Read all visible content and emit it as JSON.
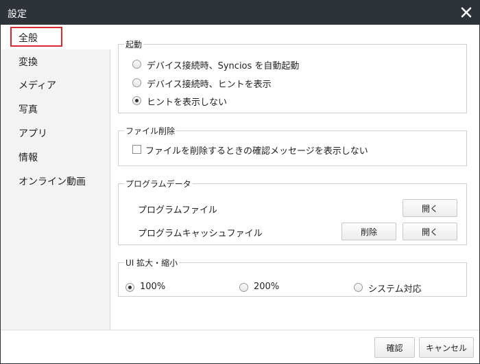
{
  "window": {
    "title": "設定"
  },
  "sidebar": {
    "items": [
      {
        "label": "全般",
        "selected": true
      },
      {
        "label": "変換"
      },
      {
        "label": "メディア"
      },
      {
        "label": "写真"
      },
      {
        "label": "アプリ"
      },
      {
        "label": "情報"
      },
      {
        "label": "オンライン動画"
      }
    ]
  },
  "startup": {
    "legend": "起動",
    "options": [
      {
        "label": "デバイス接続時、Syncios を自動起動",
        "selected": false
      },
      {
        "label": "デバイス接続時、ヒントを表示",
        "selected": false
      },
      {
        "label": "ヒントを表示しない",
        "selected": true
      }
    ]
  },
  "file_delete": {
    "legend": "ファイル削除",
    "checkbox_label": "ファイルを削除するときの確認メッセージを表示しない",
    "checked": false
  },
  "program_data": {
    "legend": "プログラムデータ",
    "rows": [
      {
        "label": "プログラムファイル",
        "open_label": "開く"
      },
      {
        "label": "プログラムキャッシュファイル",
        "delete_label": "削除",
        "open_label": "開く"
      }
    ]
  },
  "ui_scale": {
    "legend": "UI 拡大・縮小",
    "options": [
      {
        "label": "100%",
        "selected": true
      },
      {
        "label": "200%",
        "selected": false
      },
      {
        "label": "システム対応",
        "selected": false
      }
    ]
  },
  "footer": {
    "ok_label": "確認",
    "cancel_label": "キャンセル"
  },
  "colors": {
    "titlebar": "#2e3239",
    "selection_outline": "#d9282f",
    "sidebar_bg": "#f3f3f3"
  }
}
